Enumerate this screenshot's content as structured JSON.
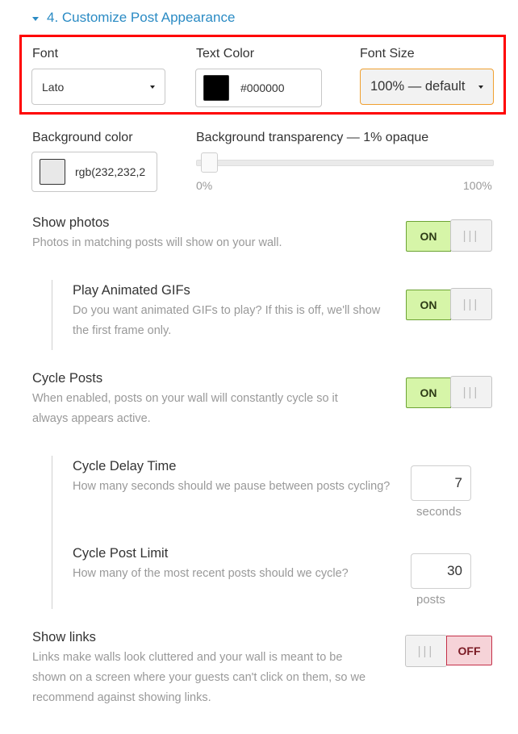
{
  "section": {
    "title": "4. Customize Post Appearance",
    "icon": "caret-down-icon"
  },
  "font": {
    "label": "Font",
    "value": "Lato"
  },
  "text_color": {
    "label": "Text Color",
    "value": "#000000",
    "swatch": "#000000"
  },
  "font_size": {
    "label": "Font Size",
    "value": "100% — default"
  },
  "background_color": {
    "label": "Background color",
    "value": "rgb(232,232,2",
    "swatch": "#e8e8e8"
  },
  "background_transparency": {
    "label": "Background transparency — 1% opaque",
    "value_percent": 1,
    "min_label": "0%",
    "max_label": "100%"
  },
  "settings": {
    "show_photos": {
      "title": "Show photos",
      "description": "Photos in matching posts will show on your wall.",
      "state": "ON"
    },
    "play_gifs": {
      "title": "Play Animated GIFs",
      "description": "Do you want animated GIFs to play? If this is off, we'll show the first frame only.",
      "state": "ON"
    },
    "cycle_posts": {
      "title": "Cycle Posts",
      "description": "When enabled, posts on your wall will constantly cycle so it always appears active.",
      "state": "ON"
    },
    "cycle_delay": {
      "title": "Cycle Delay Time",
      "description": "How many seconds should we pause between posts cycling?",
      "value": "7",
      "unit": "seconds"
    },
    "cycle_limit": {
      "title": "Cycle Post Limit",
      "description": "How many of the most recent posts should we cycle?",
      "value": "30",
      "unit": "posts"
    },
    "show_links": {
      "title": "Show links",
      "description": "Links make walls look cluttered and your wall is meant to be shown on a screen where your guests can't click on them, so we recommend against showing links.",
      "state": "OFF"
    }
  },
  "toggle_grip": "|||",
  "colors": {
    "accent": "#2b8bc4",
    "on_bg": "#d6f5a8",
    "off_bg": "#f6d3d8",
    "highlight": "#ff0000"
  }
}
